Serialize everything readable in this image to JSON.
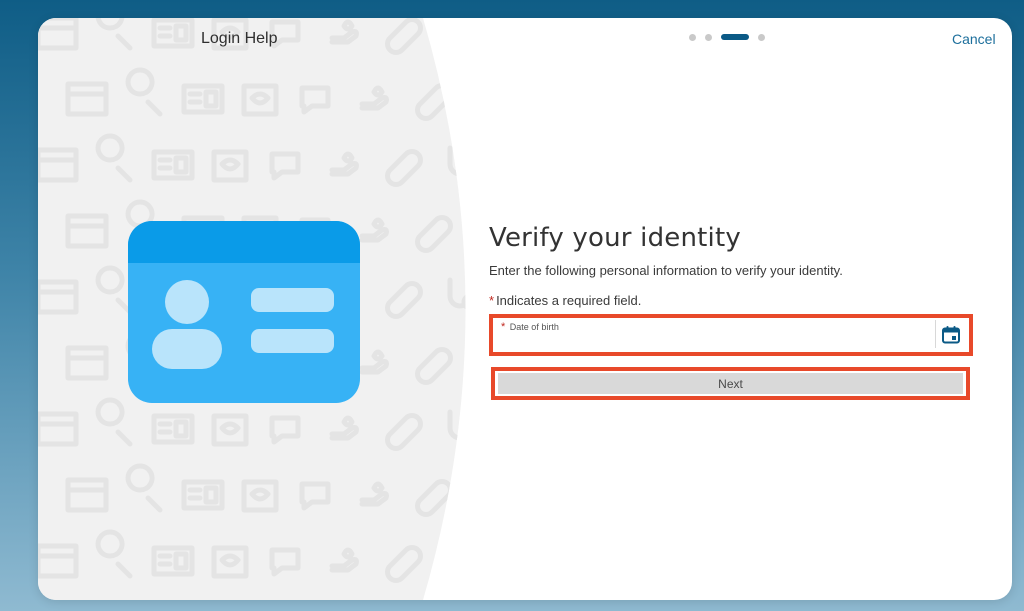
{
  "header": {
    "title": "Login Help",
    "cancel_label": "Cancel",
    "steps": {
      "total": 4,
      "current": 3
    }
  },
  "illustration": {
    "icon": "id-card-icon",
    "colors": {
      "card": "#37b2f5",
      "header": "#0a9be8",
      "bars": "#b9e4fb"
    }
  },
  "main": {
    "heading": "Verify your identity",
    "instructions": "Enter the following personal information to verify your identity.",
    "required_star": "*",
    "required_note": "Indicates a required field.",
    "dob": {
      "label": "Date of birth",
      "value": "",
      "icon": "calendar-icon"
    },
    "next_label": "Next"
  },
  "colors": {
    "accent": "#0b5a86",
    "link": "#1d6f9c",
    "highlight": "#e8492a",
    "required": "#c0281f",
    "button_disabled": "#d9d9d9"
  }
}
